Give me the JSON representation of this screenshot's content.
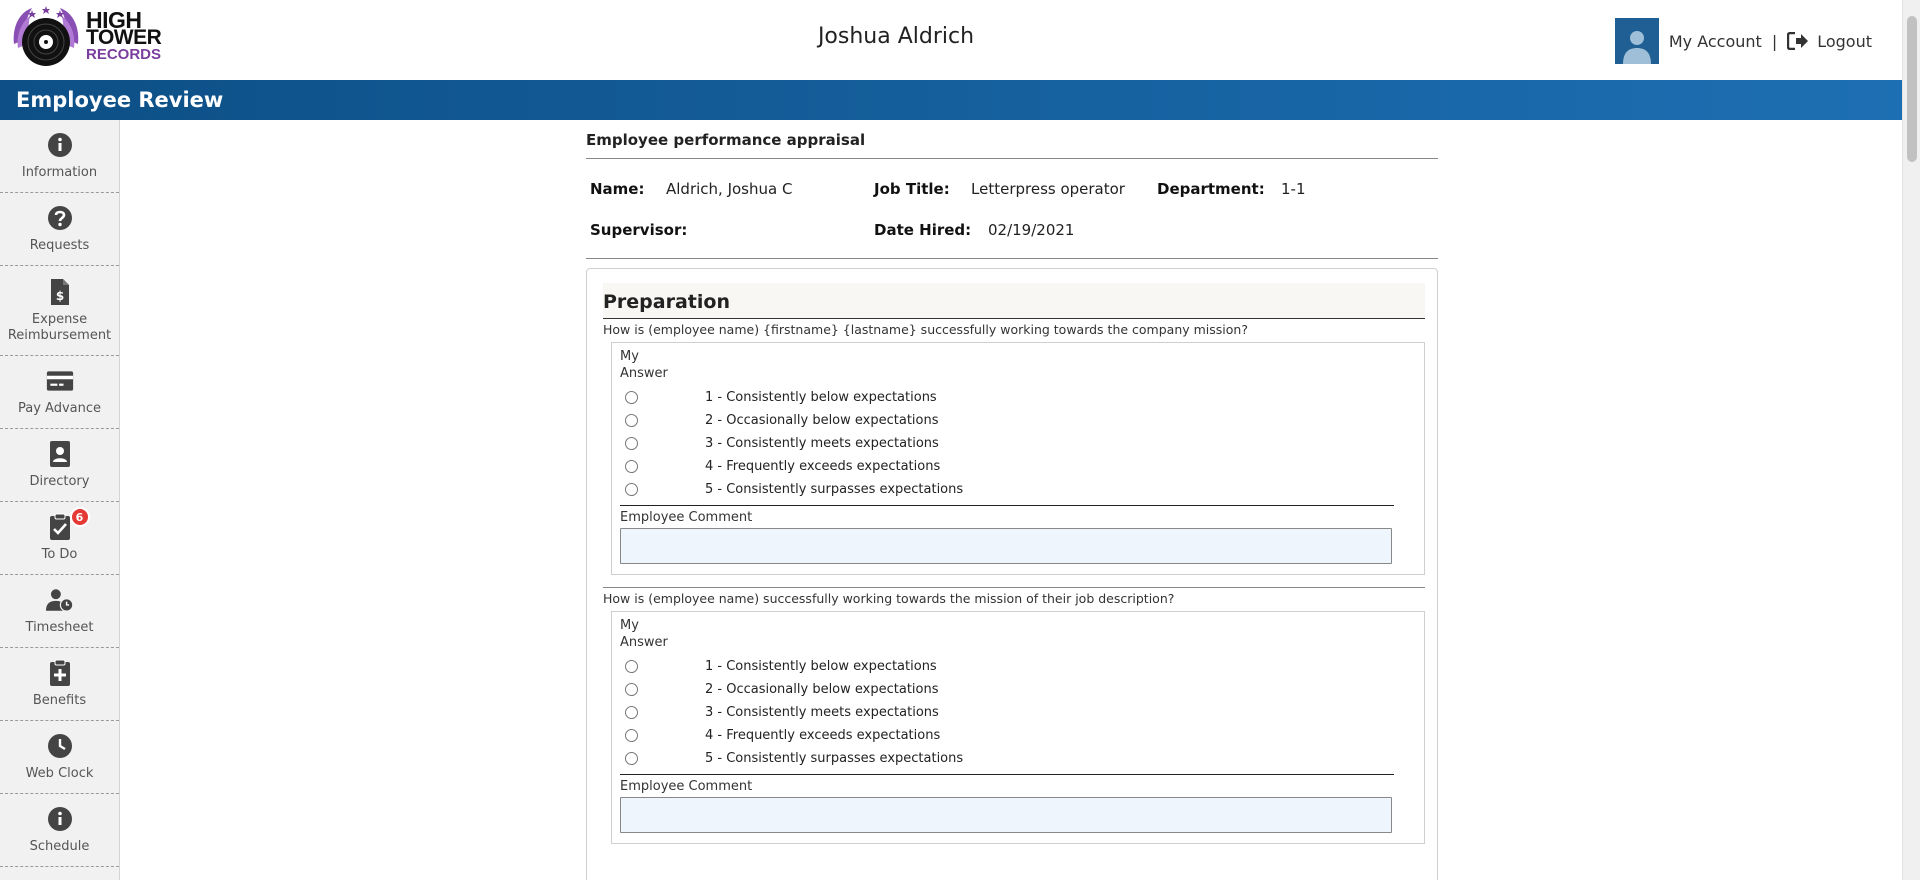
{
  "header": {
    "logo_line1": "HIGH",
    "logo_line2": "TOWER",
    "logo_line3": "RECORDS",
    "user_name": "Joshua Aldrich",
    "my_account": "My Account",
    "separator": "|",
    "logout": "Logout"
  },
  "titlebar": {
    "title": "Employee Review"
  },
  "sidebar": {
    "items": [
      {
        "label": "Information",
        "icon": "info-circle-icon"
      },
      {
        "label": "Requests",
        "icon": "question-circle-icon"
      },
      {
        "label": "Expense Reimbursement",
        "icon": "dollar-document-icon"
      },
      {
        "label": "Pay Advance",
        "icon": "credit-card-icon"
      },
      {
        "label": "Directory",
        "icon": "address-book-icon"
      },
      {
        "label": "To Do",
        "icon": "clipboard-check-icon",
        "badge": "6"
      },
      {
        "label": "Timesheet",
        "icon": "user-clock-icon"
      },
      {
        "label": "Benefits",
        "icon": "clipboard-plus-icon"
      },
      {
        "label": "Web Clock",
        "icon": "clock-icon"
      },
      {
        "label": "Schedule",
        "icon": "info-circle-icon"
      }
    ]
  },
  "appraisal": {
    "title": "Employee performance appraisal",
    "name_label": "Name:",
    "name_value": "Aldrich, Joshua C",
    "job_title_label": "Job Title:",
    "job_title_value": "Letterpress operator",
    "department_label": "Department:",
    "department_value": "1-1",
    "supervisor_label": "Supervisor:",
    "supervisor_value": "",
    "date_hired_label": "Date Hired:",
    "date_hired_value": "02/19/2021"
  },
  "section": {
    "title": "Preparation",
    "questions": [
      {
        "text": "How is (employee name) {firstname} {lastname} successfully working towards the company mission?",
        "answer_header_line1": "My",
        "answer_header_line2": "Answer",
        "options": [
          "1 - Consistently below expectations",
          "2 - Occasionally below expectations",
          "3 - Consistently meets expectations",
          "4 - Frequently exceeds expectations",
          "5 - Consistently surpasses expectations"
        ],
        "comment_label": "Employee Comment",
        "comment_value": ""
      },
      {
        "text": "How is (employee name) successfully working towards the mission of their job description?",
        "answer_header_line1": "My",
        "answer_header_line2": "Answer",
        "options": [
          "1 - Consistently below expectations",
          "2 - Occasionally below expectations",
          "3 - Consistently meets expectations",
          "4 - Frequently exceeds expectations",
          "5 - Consistently surpasses expectations"
        ],
        "comment_label": "Employee Comment",
        "comment_value": ""
      }
    ]
  },
  "colors": {
    "titlebar_start": "#0d4f86",
    "titlebar_end": "#1d6fb3",
    "avatar_bg": "#1f5f93",
    "badge": "#e53935",
    "logo_purple": "#7a3e9e",
    "comment_bg": "#eef5fd"
  }
}
